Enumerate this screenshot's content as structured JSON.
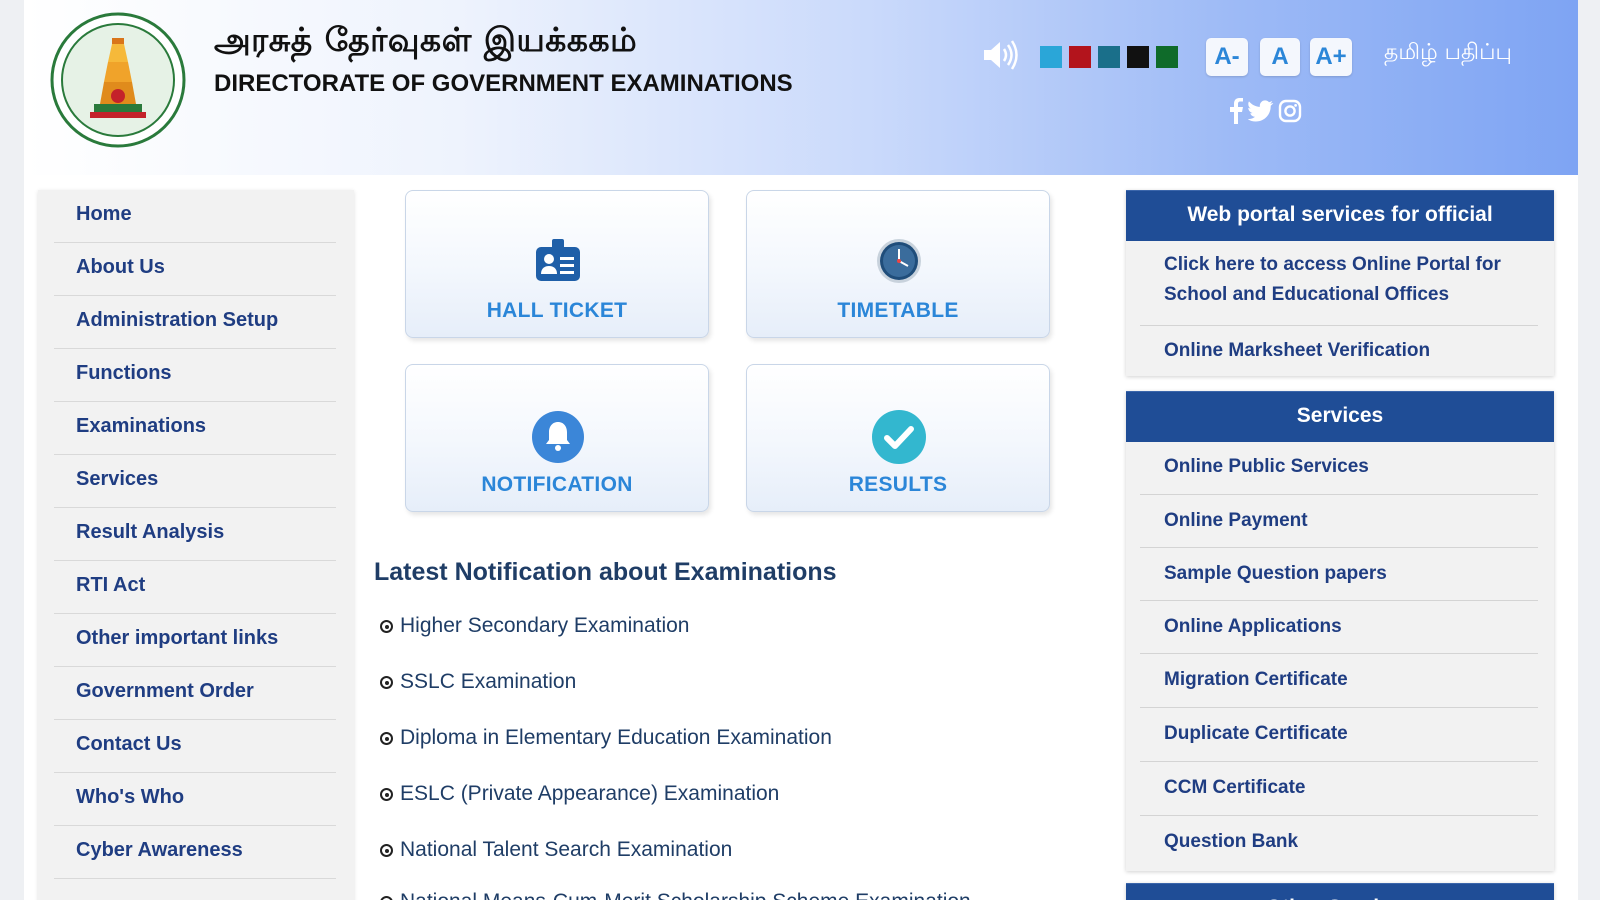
{
  "header": {
    "title_ta": "அரசுத் தேர்வுகள் இயக்ககம்",
    "title_en": "DIRECTORATE OF GOVERNMENT EXAMINATIONS",
    "font_small": "A-",
    "font_normal": "A",
    "font_large": "A+",
    "language_toggle": "தமிழ் பதிப்பு",
    "theme_colors": [
      "#2aa6d8",
      "#b3141c",
      "#1a6f8a",
      "#111111",
      "#0f6b2a"
    ]
  },
  "sidebar": {
    "items": [
      {
        "label": "Home"
      },
      {
        "label": "About Us"
      },
      {
        "label": "Administration Setup"
      },
      {
        "label": "Functions"
      },
      {
        "label": "Examinations"
      },
      {
        "label": "Services"
      },
      {
        "label": "Result Analysis"
      },
      {
        "label": "RTI Act"
      },
      {
        "label": "Other important links"
      },
      {
        "label": "Government Order"
      },
      {
        "label": "Contact Us"
      },
      {
        "label": "Who's Who"
      },
      {
        "label": "Cyber Awareness"
      }
    ]
  },
  "tiles": {
    "hall_ticket": "HALL TICKET",
    "timetable": "TIMETABLE",
    "notification": "NOTIFICATION",
    "results": "RESULTS"
  },
  "notifications": {
    "title": "Latest Notification about Examinations",
    "items": [
      "Higher Secondary Examination",
      "SSLC Examination",
      "Diploma in Elementary Education Examination",
      "ESLC (Private Appearance) Examination",
      "National Talent Search Examination",
      "National Means-Cum-Merit Scholarship Scheme Examination"
    ]
  },
  "official_panel": {
    "title": "Web portal services for official",
    "links": [
      "Click here to access Online Portal for School and Educational Offices",
      "Online Marksheet Verification"
    ]
  },
  "services_panel": {
    "title": "Services",
    "links": [
      "Online Public Services",
      "Online Payment",
      "Sample Question papers",
      "Online Applications",
      "Migration Certificate",
      "Duplicate Certificate",
      "CCM Certificate",
      "Question Bank"
    ]
  },
  "other_panel": {
    "title": "Other Services"
  },
  "colors": {
    "nav_text": "#1f3d82",
    "tile_text": "#2b86d8",
    "panel_header": "#1f4d96"
  }
}
